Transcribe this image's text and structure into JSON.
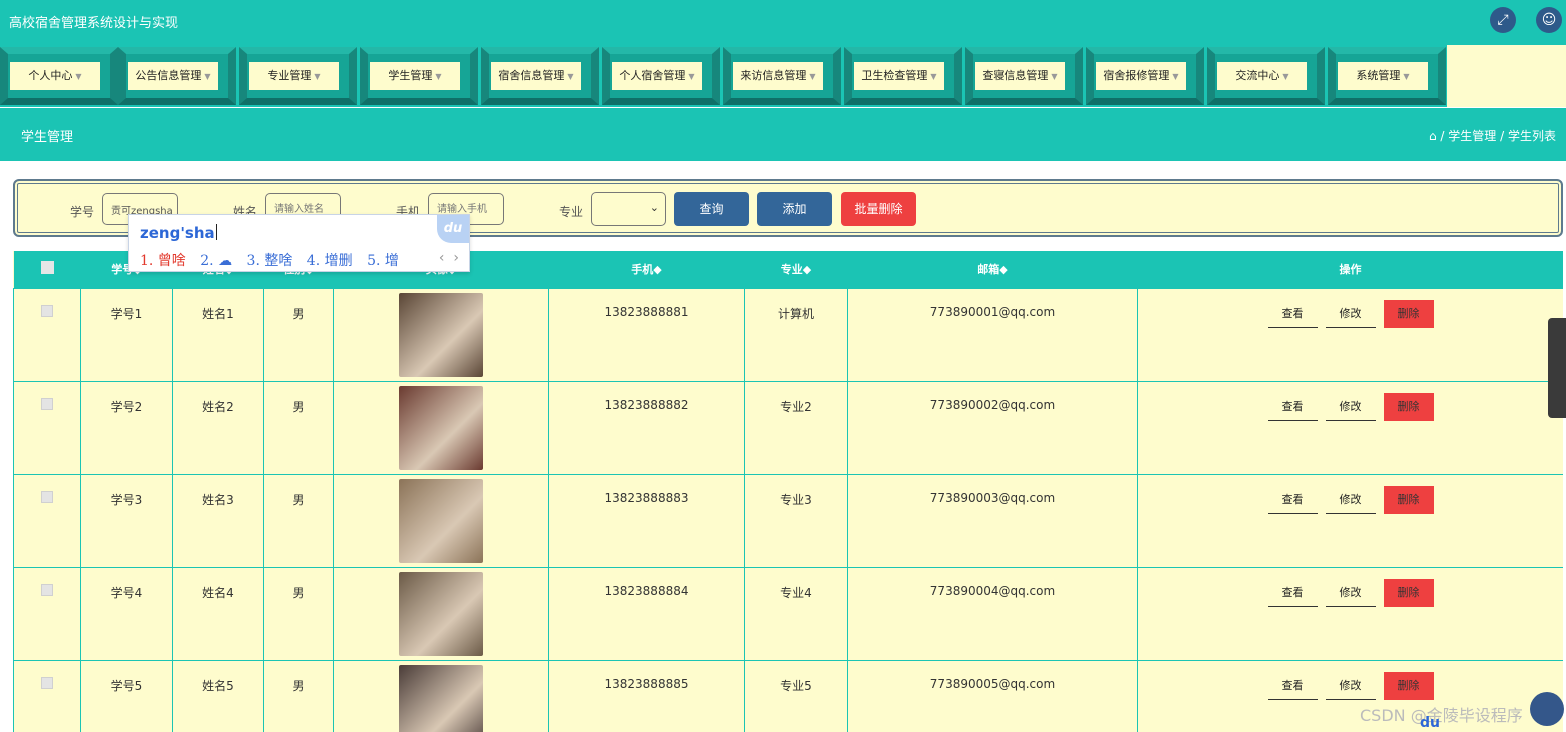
{
  "app": {
    "title": "高校宿舍管理系统设计与实现"
  },
  "icons": {
    "fullscreen": "expand-icon",
    "user": "user-icon",
    "home": "home-icon"
  },
  "colors": {
    "teal": "#1bc4b4",
    "cream": "#fefccd",
    "blue_button": "#336699",
    "red_button": "#ee4040"
  },
  "nav": [
    {
      "label": "个人中心"
    },
    {
      "label": "公告信息管理"
    },
    {
      "label": "专业管理"
    },
    {
      "label": "学生管理"
    },
    {
      "label": "宿舍信息管理"
    },
    {
      "label": "个人宿舍管理"
    },
    {
      "label": "来访信息管理"
    },
    {
      "label": "卫生检查管理"
    },
    {
      "label": "查寝信息管理"
    },
    {
      "label": "宿舍报修管理"
    },
    {
      "label": "交流中心"
    },
    {
      "label": "系统管理"
    }
  ],
  "page": {
    "title": "学生管理",
    "breadcrumb": {
      "sep": "/",
      "items": [
        "学生管理",
        "学生列表"
      ]
    }
  },
  "search": {
    "student_no_label": "学号",
    "student_no_value": "贡可zengsha",
    "name_label": "姓名",
    "name_placeholder": "请输入姓名",
    "phone_label": "手机",
    "phone_placeholder": "请输入手机",
    "major_label": "专业",
    "major_value": "",
    "query_label": "查询",
    "add_label": "添加",
    "batch_delete_label": "批量删除"
  },
  "ime": {
    "composition": "zeng'sha",
    "candidates": [
      "1. 曾啥",
      "2.",
      "3. 整啥",
      "4. 增删",
      "5. 增"
    ],
    "logo": "du"
  },
  "table": {
    "headers": [
      "学号",
      "姓名",
      "性别",
      "头像",
      "手机",
      "专业",
      "邮箱",
      "操作"
    ],
    "sort_marker": "◆",
    "actions": {
      "view": "查看",
      "edit": "修改",
      "delete": "删除"
    },
    "rows": [
      {
        "student_no": "学号1",
        "name": "姓名1",
        "gender": "男",
        "phone": "13823888881",
        "major": "计算机",
        "email": "773890001@qq.com",
        "photo_color": "#5a4636"
      },
      {
        "student_no": "学号2",
        "name": "姓名2",
        "gender": "男",
        "phone": "13823888882",
        "major": "专业2",
        "email": "773890002@qq.com",
        "photo_color": "#6a3a30"
      },
      {
        "student_no": "学号3",
        "name": "姓名3",
        "gender": "男",
        "phone": "13823888883",
        "major": "专业3",
        "email": "773890003@qq.com",
        "photo_color": "#8b7358"
      },
      {
        "student_no": "学号4",
        "name": "姓名4",
        "gender": "男",
        "phone": "13823888884",
        "major": "专业4",
        "email": "773890004@qq.com",
        "photo_color": "#6b5a47"
      },
      {
        "student_no": "学号5",
        "name": "姓名5",
        "gender": "男",
        "phone": "13823888885",
        "major": "专业5",
        "email": "773890005@qq.com",
        "photo_color": "#4a3c38"
      }
    ]
  },
  "watermark": "CSDN @金陵毕设程序"
}
